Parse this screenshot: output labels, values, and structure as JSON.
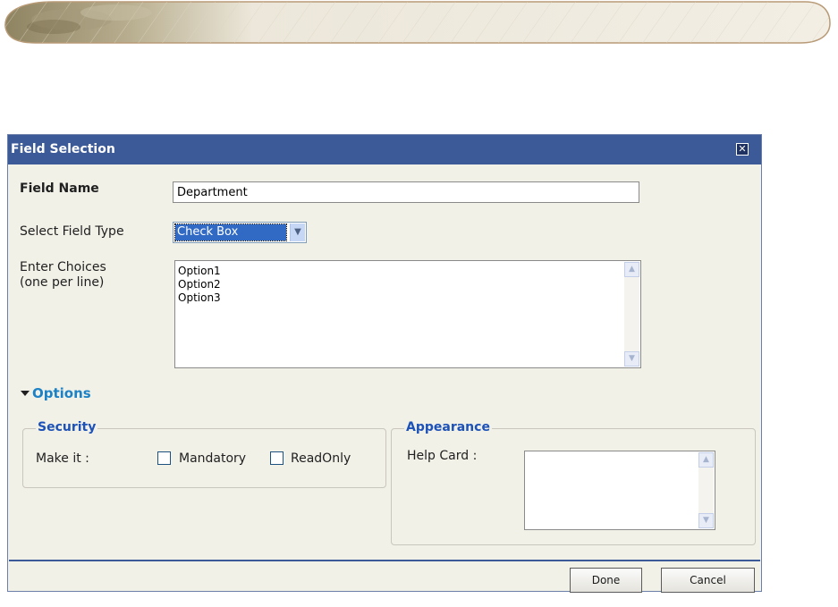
{
  "dialog": {
    "title": "Field Selection",
    "close_icon": "close-icon"
  },
  "form": {
    "field_name_label": "Field Name",
    "field_name_value": "Department",
    "field_type_label": "Select Field Type",
    "field_type_value": "Check Box",
    "choices_label_line1": "Enter Choices",
    "choices_label_line2": "(one per line)",
    "choices_value": "Option1\nOption2\nOption3"
  },
  "options": {
    "toggle_label": "Options",
    "security": {
      "legend": "Security",
      "make_it_label": "Make it :",
      "mandatory_label": "Mandatory",
      "mandatory_checked": false,
      "readonly_label": "ReadOnly",
      "readonly_checked": false
    },
    "appearance": {
      "legend": "Appearance",
      "help_card_label": "Help Card :",
      "help_card_value": ""
    }
  },
  "footer": {
    "done_label": "Done",
    "cancel_label": "Cancel"
  },
  "colors": {
    "titlebar": "#3c5a98",
    "dialog_bg": "#f2f1e8",
    "accent_link": "#1d82c5",
    "legend": "#1d52b8",
    "selection": "#316ac5"
  }
}
